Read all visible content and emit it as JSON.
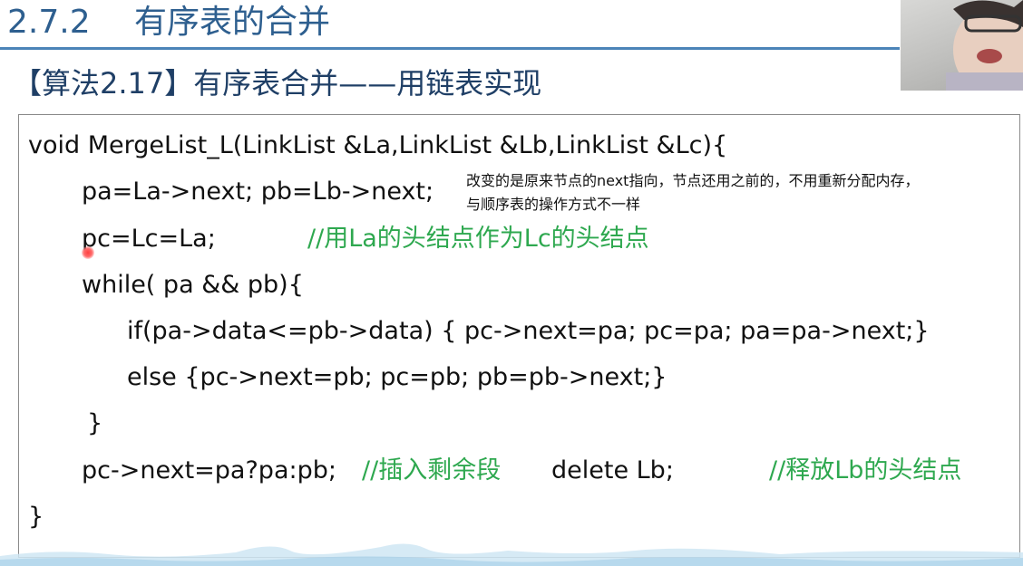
{
  "header": {
    "section_number": "2.7.2",
    "section_title": "有序表的合并"
  },
  "algorithm_title": "【算法2.17】有序表合并——用链表实现",
  "code": {
    "line1": "void MergeList_L(LinkList &La,LinkList &Lb,LinkList &Lc){",
    "line2": "pa=La->next;  pb=Lb->next;",
    "line3": "pc=Lc=La;",
    "line3_comment": "//用La的头结点作为Lc的头结点",
    "line4": "while( pa && pb){",
    "line5": "if(pa->data<=pb->data) { pc->next=pa; pc=pa; pa=pa->next;}",
    "line6": "else {pc->next=pb; pc=pb; pb=pb->next;}",
    "line7": "}",
    "line8": "pc->next=pa?pa:pb;",
    "line8_comment": "//插入剩余段",
    "line8_extra": "delete Lb;",
    "line8_comment2": "//释放Lb的头结点",
    "line9": "}"
  },
  "annotation": {
    "line1": "改变的是原来节点的next指向，节点还用之前的，不用重新分配内存，",
    "line2": "与顺序表的操作方式不一样"
  },
  "colors": {
    "title": "#2e5f8f",
    "rule": "#4b84b8",
    "comment": "#2ea84f",
    "cursor": "#ff4040"
  }
}
